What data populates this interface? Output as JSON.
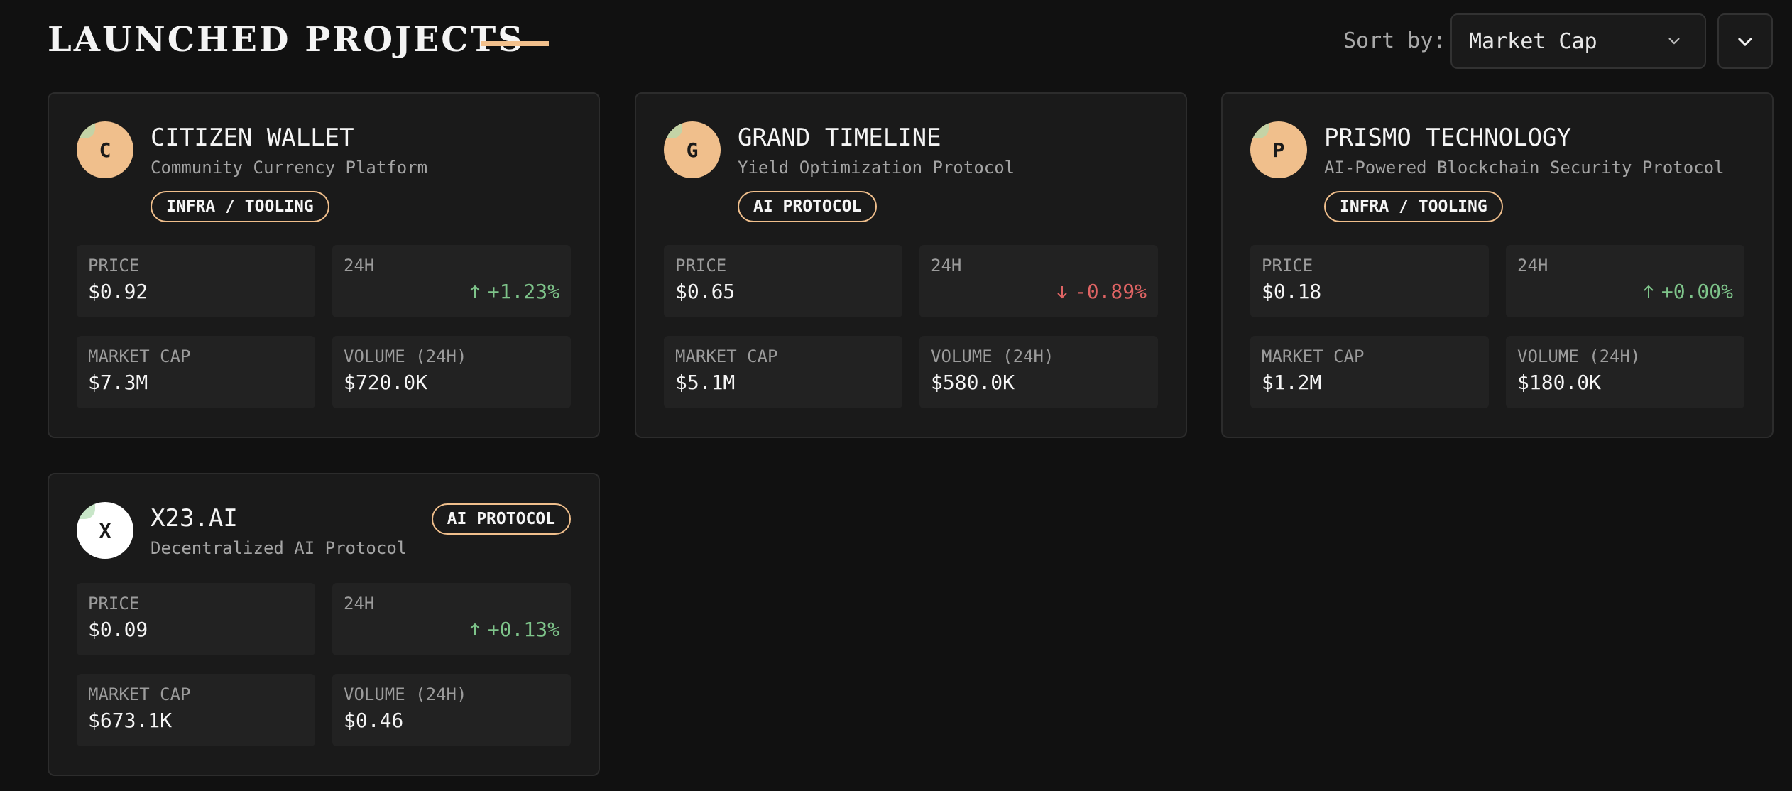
{
  "header": {
    "title": "LAUNCHED PROJECTS",
    "sort_label": "Sort by:",
    "sort_value": "Market Cap",
    "accent_color": "#f2c08c"
  },
  "labels": {
    "price": "PRICE",
    "change": "24H",
    "market_cap": "MARKET CAP",
    "volume": "VOLUME (24H)"
  },
  "projects": [
    {
      "initial": "C",
      "name": "CITIZEN WALLET",
      "subtitle": "Community Currency Platform",
      "tag": "INFRA / TOOLING",
      "price": "$0.92",
      "change": "+1.23%",
      "direction": "up",
      "market_cap": "$7.3M",
      "volume": "$720.0K"
    },
    {
      "initial": "G",
      "name": "GRAND TIMELINE",
      "subtitle": "Yield Optimization Protocol",
      "tag": "AI PROTOCOL",
      "price": "$0.65",
      "change": "-0.89%",
      "direction": "down",
      "market_cap": "$5.1M",
      "volume": "$580.0K"
    },
    {
      "initial": "P",
      "name": "PRISMO TECHNOLOGY",
      "subtitle": "AI-Powered Blockchain Security Protocol",
      "tag": "INFRA / TOOLING",
      "price": "$0.18",
      "change": "+0.00%",
      "direction": "up",
      "market_cap": "$1.2M",
      "volume": "$180.0K"
    },
    {
      "initial": "X",
      "name": "X23.AI",
      "subtitle": "Decentralized AI Protocol",
      "tag": "AI PROTOCOL",
      "price": "$0.09",
      "change": "+0.13%",
      "direction": "up",
      "market_cap": "$673.1K",
      "volume": "$0.46"
    }
  ]
}
